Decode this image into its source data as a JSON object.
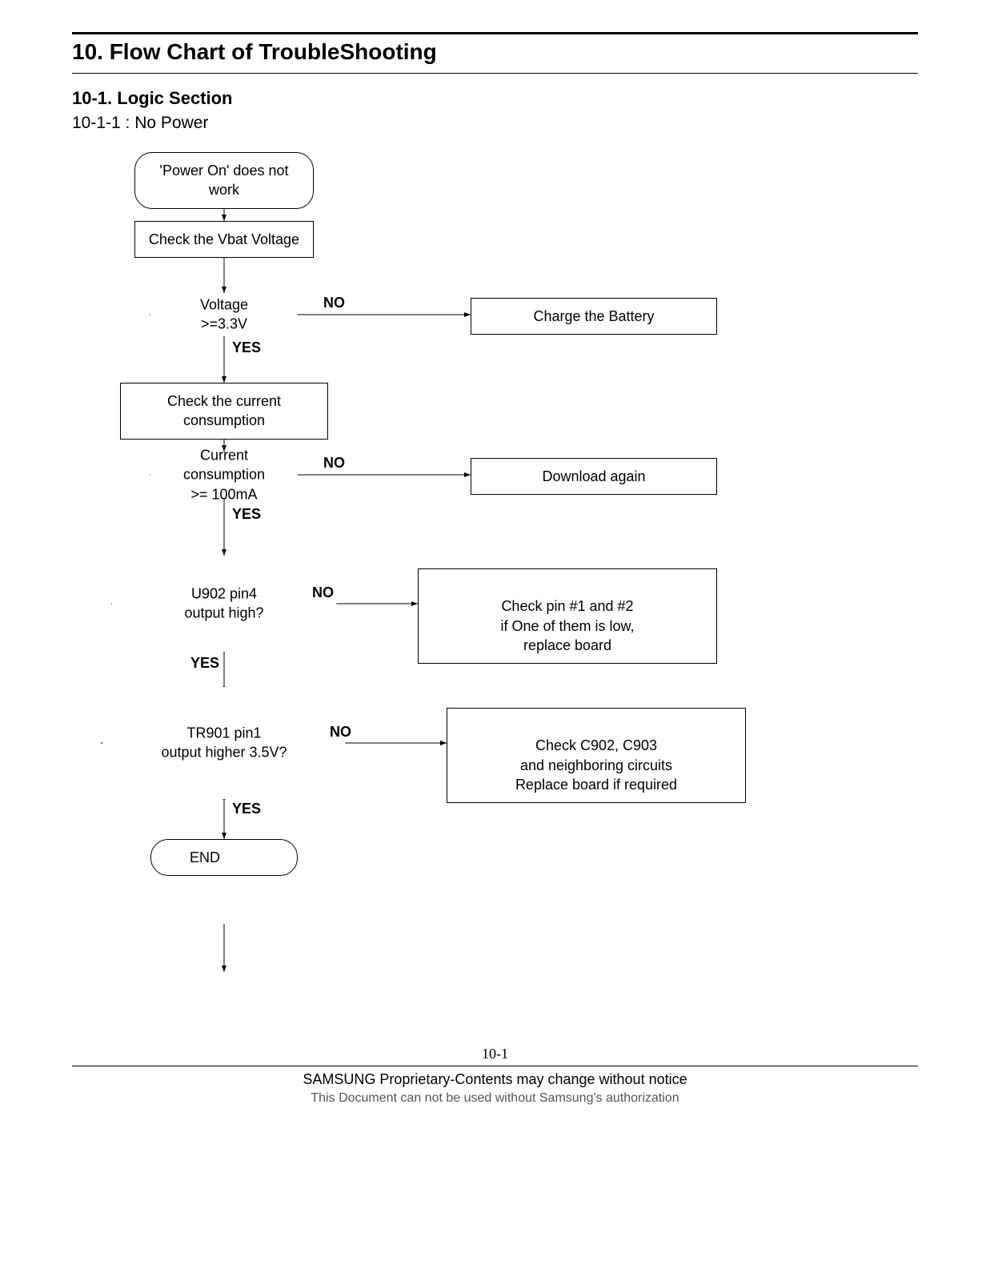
{
  "header": {
    "title": "10. Flow Chart of TroubleShooting",
    "section": "10-1. Logic Section",
    "subsection": "10-1-1 : No Power"
  },
  "nodes": {
    "start": "'Power On' does not work",
    "check_vbat": "Check the Vbat Voltage",
    "voltage_decision": "Voltage >=3.3V",
    "charge_battery": "Charge the Battery",
    "check_current": "Check the current consumption",
    "current_decision": "Current consumption\n>= 100mA",
    "download_again": "Download again",
    "u902_decision": "U902 pin4\noutput high?",
    "check_pins": "Check pin #1 and #2\nif One of them is low,\nreplace board",
    "tr901_decision": "TR901 pin1\noutput higher 3.5V?",
    "check_c902": "Check C902, C903\nand neighboring circuits\nReplace board if required",
    "end": "END"
  },
  "labels": {
    "yes": "YES",
    "no": "NO"
  },
  "footer": {
    "page_number": "10-1",
    "line1": "SAMSUNG Proprietary-Contents may change without notice",
    "line2": "This Document can not be used without Samsung's authorization"
  },
  "chart_data": {
    "type": "flowchart",
    "title": "No Power troubleshooting",
    "nodes": [
      {
        "id": "start",
        "shape": "terminator",
        "label": "'Power On' does not work"
      },
      {
        "id": "vbat",
        "shape": "process",
        "label": "Check the Vbat Voltage"
      },
      {
        "id": "d1",
        "shape": "decision",
        "label": "Voltage >=3.3V"
      },
      {
        "id": "charge",
        "shape": "process",
        "label": "Charge the Battery"
      },
      {
        "id": "curr",
        "shape": "process",
        "label": "Check the current consumption"
      },
      {
        "id": "d2",
        "shape": "decision",
        "label": "Current consumption >= 100mA"
      },
      {
        "id": "dl",
        "shape": "process",
        "label": "Download again"
      },
      {
        "id": "d3",
        "shape": "decision",
        "label": "U902 pin4 output high?",
        "highlight": "red"
      },
      {
        "id": "pins",
        "shape": "process",
        "label": "Check pin #1 and #2 if One of them is low, replace board"
      },
      {
        "id": "d4",
        "shape": "decision",
        "label": "TR901 pin1 output higher 3.5V?",
        "highlight": "darkred"
      },
      {
        "id": "c902",
        "shape": "process",
        "label": "Check C902, C903 and neighboring circuits Replace board if required"
      },
      {
        "id": "end",
        "shape": "terminator",
        "label": "END"
      }
    ],
    "edges": [
      {
        "from": "start",
        "to": "vbat"
      },
      {
        "from": "vbat",
        "to": "d1"
      },
      {
        "from": "d1",
        "to": "charge",
        "label": "NO"
      },
      {
        "from": "d1",
        "to": "curr",
        "label": "YES"
      },
      {
        "from": "curr",
        "to": "d2"
      },
      {
        "from": "d2",
        "to": "dl",
        "label": "NO"
      },
      {
        "from": "d2",
        "to": "d3",
        "label": "YES"
      },
      {
        "from": "d3",
        "to": "pins",
        "label": "NO"
      },
      {
        "from": "d3",
        "to": "d4",
        "label": "YES"
      },
      {
        "from": "d4",
        "to": "c902",
        "label": "NO"
      },
      {
        "from": "d4",
        "to": "end",
        "label": "YES"
      }
    ]
  }
}
